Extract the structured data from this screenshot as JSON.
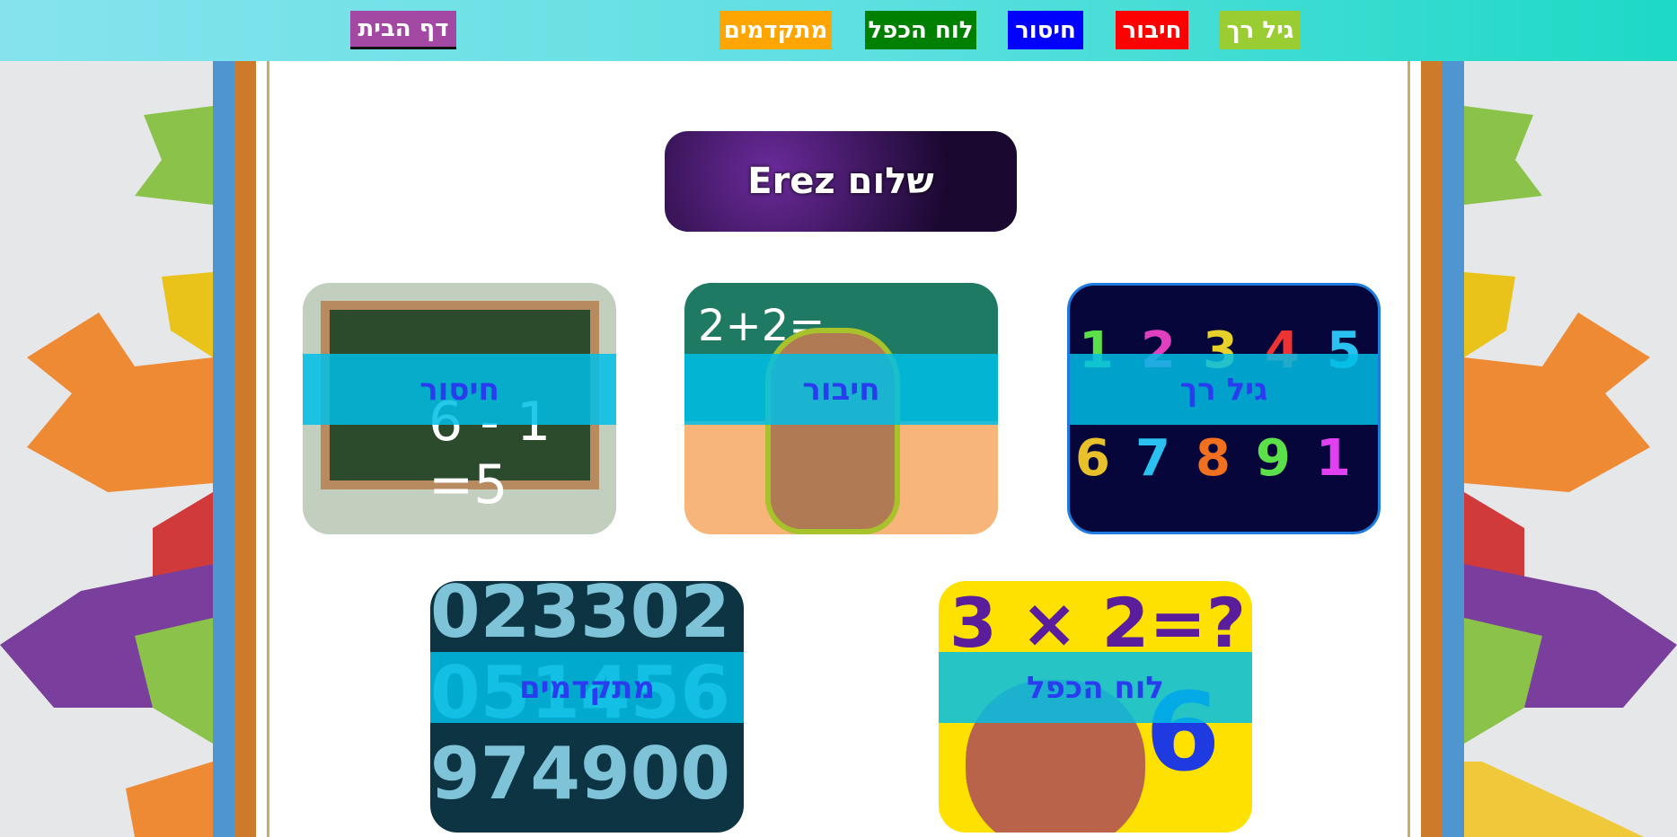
{
  "nav": {
    "home": "דף הבית",
    "items": [
      {
        "label": "גיל רך",
        "color": "#9acd32"
      },
      {
        "label": "חיבור",
        "color": "#ff0000"
      },
      {
        "label": "חיסור",
        "color": "#0000ff"
      },
      {
        "label": "לוח הכפל",
        "color": "#008000"
      },
      {
        "label": "מתקדמים",
        "color": "#ffa500"
      }
    ],
    "home_color": "#a349a4"
  },
  "greeting": "שלום Erez",
  "cards": [
    {
      "label": "גיל רך"
    },
    {
      "label": "חיבור"
    },
    {
      "label": "חיסור"
    },
    {
      "label": "לוח הכפל"
    },
    {
      "label": "מתקדמים"
    }
  ]
}
